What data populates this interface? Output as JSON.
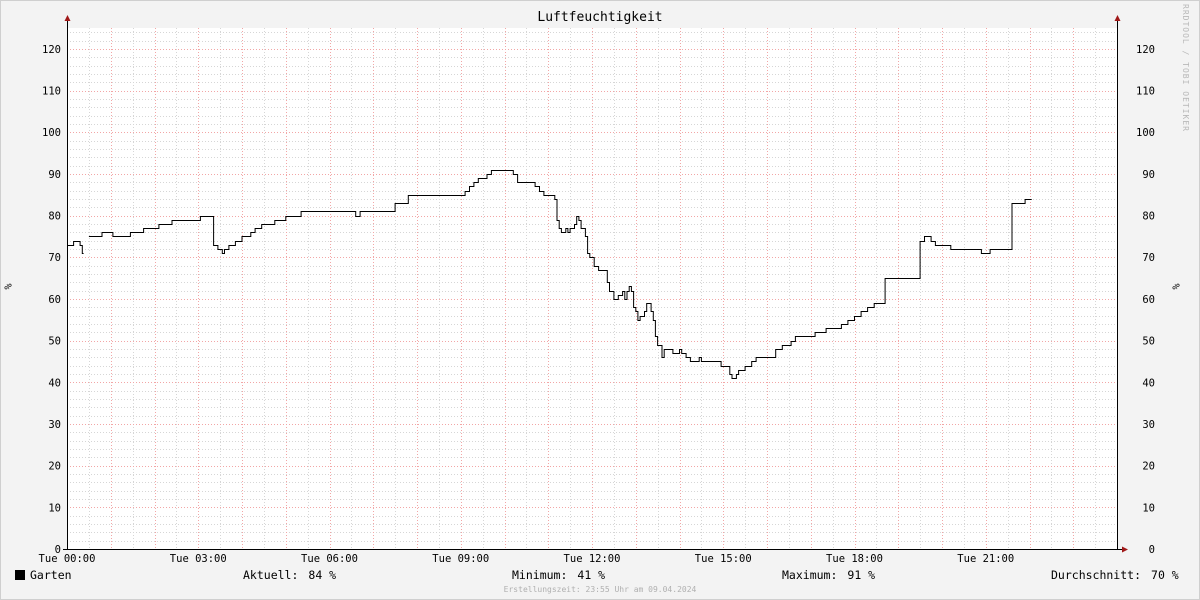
{
  "watermark": "RRDTOOL / TOBI OETIKER",
  "legend": {
    "series_label": "Garten",
    "current_label": "Aktuell:",
    "current_value": "84 %",
    "min_label": "Minimum:",
    "min_value": "41 %",
    "max_label": "Maximum:",
    "max_value": "91 %",
    "avg_label": "Durchschnitt:",
    "avg_value": "70 %"
  },
  "footer": "Erstellungszeit: 23:55 Uhr am 09.04.2024",
  "colors": {
    "background": "#f3f3f3",
    "plot": "#ffffff",
    "grid_minor": "#d6d6d6",
    "grid_major": "#f2a6a6",
    "line": "#000000",
    "axis_arrow": "#a01818"
  },
  "chart_data": {
    "type": "line",
    "title": "Luftfeuchtigkeit",
    "ylabel": "%",
    "ylim": [
      0,
      125
    ],
    "xlim": [
      0,
      24
    ],
    "yticks": [
      0,
      10,
      20,
      30,
      40,
      50,
      60,
      70,
      80,
      90,
      100,
      110,
      120
    ],
    "xticks": [
      {
        "x": 0,
        "label": "Tue 00:00"
      },
      {
        "x": 3,
        "label": "Tue 03:00"
      },
      {
        "x": 6,
        "label": "Tue 06:00"
      },
      {
        "x": 9,
        "label": "Tue 09:00"
      },
      {
        "x": 12,
        "label": "Tue 12:00"
      },
      {
        "x": 15,
        "label": "Tue 15:00"
      },
      {
        "x": 18,
        "label": "Tue 18:00"
      },
      {
        "x": 21,
        "label": "Tue 21:00"
      }
    ],
    "grid": true,
    "legend_position": "bottom",
    "series": [
      {
        "name": "Garten",
        "segments": [
          [
            [
              0,
              73
            ],
            [
              0.15,
              73
            ],
            [
              0.15,
              74
            ],
            [
              0.3,
              74
            ],
            [
              0.3,
              73
            ],
            [
              0.35,
              73
            ],
            [
              0.35,
              71
            ],
            [
              0.38,
              71
            ]
          ],
          [
            [
              0.5,
              75
            ],
            [
              0.8,
              75
            ],
            [
              0.8,
              76
            ],
            [
              1.05,
              76
            ],
            [
              1.05,
              75
            ],
            [
              1.45,
              75
            ],
            [
              1.45,
              76
            ],
            [
              1.75,
              76
            ],
            [
              1.75,
              77
            ],
            [
              2.1,
              77
            ],
            [
              2.1,
              78
            ],
            [
              2.4,
              78
            ],
            [
              2.4,
              79
            ],
            [
              3.05,
              79
            ],
            [
              3.05,
              80
            ],
            [
              3.35,
              80
            ],
            [
              3.35,
              73
            ],
            [
              3.45,
              73
            ],
            [
              3.45,
              72
            ],
            [
              3.55,
              72
            ],
            [
              3.55,
              71
            ],
            [
              3.6,
              71
            ],
            [
              3.6,
              72
            ],
            [
              3.7,
              72
            ],
            [
              3.7,
              73
            ],
            [
              3.85,
              73
            ],
            [
              3.85,
              74
            ],
            [
              4.0,
              74
            ],
            [
              4.0,
              75
            ],
            [
              4.2,
              75
            ],
            [
              4.2,
              76
            ],
            [
              4.3,
              76
            ],
            [
              4.3,
              77
            ],
            [
              4.45,
              77
            ],
            [
              4.45,
              78
            ],
            [
              4.75,
              78
            ],
            [
              4.75,
              79
            ],
            [
              5.0,
              79
            ],
            [
              5.0,
              80
            ],
            [
              5.35,
              80
            ],
            [
              5.35,
              81
            ],
            [
              6.6,
              81
            ],
            [
              6.6,
              80
            ],
            [
              6.7,
              80
            ],
            [
              6.7,
              81
            ],
            [
              7.5,
              81
            ],
            [
              7.5,
              83
            ],
            [
              7.8,
              83
            ],
            [
              7.8,
              85
            ],
            [
              9.1,
              85
            ],
            [
              9.1,
              86
            ],
            [
              9.2,
              86
            ],
            [
              9.2,
              87
            ],
            [
              9.3,
              87
            ],
            [
              9.3,
              88
            ],
            [
              9.4,
              88
            ],
            [
              9.4,
              89
            ],
            [
              9.6,
              89
            ],
            [
              9.6,
              90
            ],
            [
              9.7,
              90
            ],
            [
              9.7,
              91
            ],
            [
              10.2,
              91
            ],
            [
              10.2,
              90
            ],
            [
              10.3,
              90
            ],
            [
              10.3,
              88
            ],
            [
              10.7,
              88
            ],
            [
              10.7,
              87
            ],
            [
              10.8,
              87
            ],
            [
              10.8,
              86
            ],
            [
              10.9,
              86
            ],
            [
              10.9,
              85
            ],
            [
              11.15,
              85
            ],
            [
              11.15,
              84
            ],
            [
              11.2,
              84
            ],
            [
              11.2,
              79
            ],
            [
              11.25,
              79
            ],
            [
              11.25,
              77
            ],
            [
              11.3,
              77
            ],
            [
              11.3,
              76
            ],
            [
              11.4,
              76
            ],
            [
              11.4,
              77
            ],
            [
              11.45,
              77
            ],
            [
              11.45,
              76
            ],
            [
              11.5,
              76
            ],
            [
              11.5,
              77
            ],
            [
              11.6,
              77
            ],
            [
              11.6,
              78
            ],
            [
              11.65,
              78
            ],
            [
              11.65,
              80
            ],
            [
              11.7,
              80
            ],
            [
              11.7,
              79
            ],
            [
              11.75,
              79
            ],
            [
              11.75,
              77
            ],
            [
              11.85,
              77
            ],
            [
              11.85,
              75
            ],
            [
              11.9,
              75
            ],
            [
              11.9,
              71
            ],
            [
              11.95,
              71
            ],
            [
              11.95,
              70
            ],
            [
              12.05,
              70
            ],
            [
              12.05,
              68
            ],
            [
              12.15,
              68
            ],
            [
              12.15,
              67
            ],
            [
              12.35,
              67
            ],
            [
              12.35,
              64
            ],
            [
              12.4,
              64
            ],
            [
              12.4,
              62
            ],
            [
              12.5,
              62
            ],
            [
              12.5,
              60
            ],
            [
              12.6,
              60
            ],
            [
              12.6,
              61
            ],
            [
              12.7,
              61
            ],
            [
              12.7,
              62
            ],
            [
              12.75,
              62
            ],
            [
              12.75,
              60
            ],
            [
              12.8,
              60
            ],
            [
              12.8,
              62
            ],
            [
              12.85,
              62
            ],
            [
              12.85,
              63
            ],
            [
              12.9,
              63
            ],
            [
              12.9,
              62
            ],
            [
              12.95,
              62
            ],
            [
              12.95,
              58
            ],
            [
              13.0,
              58
            ],
            [
              13.0,
              57
            ],
            [
              13.05,
              57
            ],
            [
              13.05,
              55
            ],
            [
              13.1,
              55
            ],
            [
              13.1,
              56
            ],
            [
              13.2,
              56
            ],
            [
              13.2,
              57
            ],
            [
              13.25,
              57
            ],
            [
              13.25,
              59
            ],
            [
              13.35,
              59
            ],
            [
              13.35,
              57
            ],
            [
              13.4,
              57
            ],
            [
              13.4,
              55
            ],
            [
              13.45,
              55
            ],
            [
              13.45,
              51
            ],
            [
              13.5,
              51
            ],
            [
              13.5,
              49
            ],
            [
              13.6,
              49
            ],
            [
              13.6,
              46
            ],
            [
              13.65,
              46
            ],
            [
              13.65,
              48
            ],
            [
              13.85,
              48
            ],
            [
              13.85,
              47
            ],
            [
              14.0,
              47
            ],
            [
              14.0,
              48
            ],
            [
              14.05,
              48
            ],
            [
              14.05,
              47
            ],
            [
              14.15,
              47
            ],
            [
              14.15,
              46
            ],
            [
              14.25,
              46
            ],
            [
              14.25,
              45
            ],
            [
              14.45,
              45
            ],
            [
              14.45,
              46
            ],
            [
              14.5,
              46
            ],
            [
              14.5,
              45
            ],
            [
              14.95,
              45
            ],
            [
              14.95,
              44
            ],
            [
              15.15,
              44
            ],
            [
              15.15,
              42
            ],
            [
              15.2,
              42
            ],
            [
              15.2,
              41
            ],
            [
              15.3,
              41
            ],
            [
              15.3,
              42
            ],
            [
              15.35,
              42
            ],
            [
              15.35,
              43
            ],
            [
              15.5,
              43
            ],
            [
              15.5,
              44
            ],
            [
              15.65,
              44
            ],
            [
              15.65,
              45
            ],
            [
              15.75,
              45
            ],
            [
              15.75,
              46
            ],
            [
              16.2,
              46
            ],
            [
              16.2,
              48
            ],
            [
              16.35,
              48
            ],
            [
              16.35,
              49
            ],
            [
              16.55,
              49
            ],
            [
              16.55,
              50
            ],
            [
              16.65,
              50
            ],
            [
              16.65,
              51
            ],
            [
              17.1,
              51
            ],
            [
              17.1,
              52
            ],
            [
              17.35,
              52
            ],
            [
              17.35,
              53
            ],
            [
              17.7,
              53
            ],
            [
              17.7,
              54
            ],
            [
              17.85,
              54
            ],
            [
              17.85,
              55
            ],
            [
              18.0,
              55
            ],
            [
              18.0,
              56
            ],
            [
              18.15,
              56
            ],
            [
              18.15,
              57
            ],
            [
              18.3,
              57
            ],
            [
              18.3,
              58
            ],
            [
              18.45,
              58
            ],
            [
              18.45,
              59
            ],
            [
              18.7,
              59
            ],
            [
              18.7,
              65
            ],
            [
              19.5,
              65
            ],
            [
              19.5,
              74
            ],
            [
              19.6,
              74
            ],
            [
              19.6,
              75
            ],
            [
              19.75,
              75
            ],
            [
              19.75,
              74
            ],
            [
              19.85,
              74
            ],
            [
              19.85,
              73
            ],
            [
              20.2,
              73
            ],
            [
              20.2,
              72
            ],
            [
              20.9,
              72
            ],
            [
              20.9,
              71
            ],
            [
              21.1,
              71
            ],
            [
              21.1,
              72
            ],
            [
              21.6,
              72
            ],
            [
              21.6,
              83
            ],
            [
              21.9,
              83
            ],
            [
              21.9,
              84
            ],
            [
              22.05,
              84
            ]
          ]
        ]
      }
    ]
  }
}
